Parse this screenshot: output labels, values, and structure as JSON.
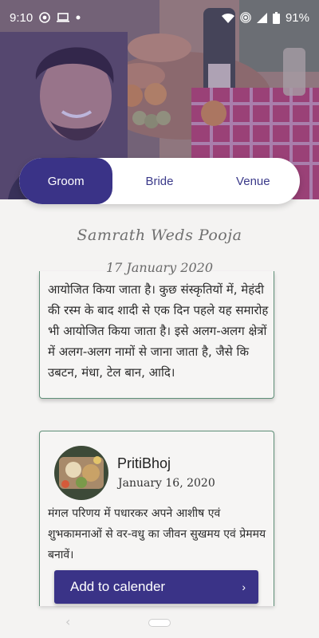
{
  "status_bar": {
    "time": "9:10",
    "battery": "91%"
  },
  "tabs": [
    {
      "label": "Groom",
      "active": true
    },
    {
      "label": "Bride",
      "active": false
    },
    {
      "label": "Venue",
      "active": false
    }
  ],
  "header": {
    "title": "Samrath Weds Pooja",
    "date": "17 January 2020"
  },
  "card1": {
    "text": "आयोजित किया जाता है। कुछ संस्कृतियों में, मेहंदी की रस्म के बाद शादी से एक दिन पहले यह समारोह भी आयोजित किया जाता है। इसे अलग-अलग क्षेत्रों में अलग-अलग नामों से जाना जाता है, जैसे कि उबटन, मंधा, टेल बान, आदि।"
  },
  "event": {
    "name": "PritiBhoj",
    "date": "January 16, 2020",
    "description": "मंगल परिणय में पधारकर अपने आशीष एवं शुभकामनाओं से वर-वधु का जीवन सुखमय एवं प्रेममय बनावें।",
    "button_label": "Add to calender"
  },
  "colors": {
    "primary": "#3a3387",
    "card_border": "#5f8f78"
  }
}
